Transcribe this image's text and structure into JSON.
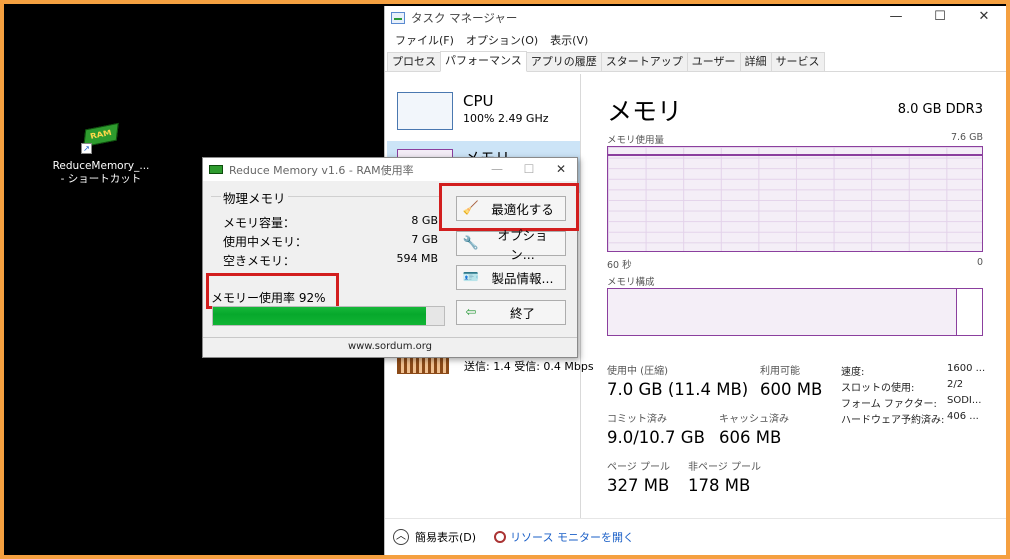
{
  "desktop": {
    "shortcut": {
      "chip_text": "RAM",
      "label_line1": "ReduceMemory_...",
      "label_line2": "- ショートカット"
    }
  },
  "taskmanager": {
    "title": "タスク マネージャー",
    "window_buttons": [
      "—",
      "☐",
      "✕"
    ],
    "menu": [
      "ファイル(F)",
      "オプション(O)",
      "表示(V)"
    ],
    "tabs": [
      "プロセス",
      "パフォーマンス",
      "アプリの履歴",
      "スタートアップ",
      "ユーザー",
      "詳細",
      "サービス"
    ],
    "active_tab": "パフォーマンス",
    "sidebar": {
      "cpu_name": "CPU",
      "cpu_detail": "100%  2.49 GHz",
      "mem_name": "メモリ",
      "net_detail": "送信: 1.4  受信: 0.4 Mbps"
    },
    "main": {
      "title": "メモリ",
      "spec": "8.0 GB DDR3",
      "usage_label": "メモリ使用量",
      "usage_max": "7.6 GB",
      "time_left": "60 秒",
      "time_right": "0",
      "composition_label": "メモリ構成",
      "stats": {
        "in_use_label": "使用中 (圧縮)",
        "in_use_value": "7.0 GB (11.4 MB)",
        "available_label": "利用可能",
        "available_value": "600 MB",
        "committed_label": "コミット済み",
        "committed_value": "9.0/10.7 GB",
        "cached_label": "キャッシュ済み",
        "cached_value": "606 MB",
        "paged_label": "ページ プール",
        "paged_value": "327 MB",
        "nonpaged_label": "非ページ プール",
        "nonpaged_value": "178 MB"
      },
      "details": [
        {
          "key": "速度:",
          "value": "1600 ..."
        },
        {
          "key": "スロットの使用:",
          "value": "2/2"
        },
        {
          "key": "フォーム ファクター:",
          "value": "SODI..."
        },
        {
          "key": "ハードウェア予約済み:",
          "value": "406 ..."
        }
      ]
    },
    "footer": {
      "fewer_details": "簡易表示(D)",
      "resource_monitor": "リソース モニターを開く"
    }
  },
  "reducememory": {
    "title": "Reduce Memory v1.6 - RAM使用率",
    "group_title": "物理メモリ",
    "rows": [
      {
        "label": "メモリ容量：",
        "value": "8 GB"
      },
      {
        "label": "使用中メモリ：",
        "value": "7 GB"
      },
      {
        "label": "空きメモリ：",
        "value": "594 MB"
      }
    ],
    "usage_label": "メモリー使用率 92%",
    "usage_percent": 92,
    "buttons": {
      "optimize": "最適化する",
      "options": "オプション...",
      "product_info": "製品情報...",
      "exit": "終了"
    },
    "url": "www.sordum.org"
  },
  "colors": {
    "frame": "#f5a040",
    "highlight": "#d21e1e",
    "memory_graph": "#8b3f9e",
    "progress": "#07a82c"
  }
}
